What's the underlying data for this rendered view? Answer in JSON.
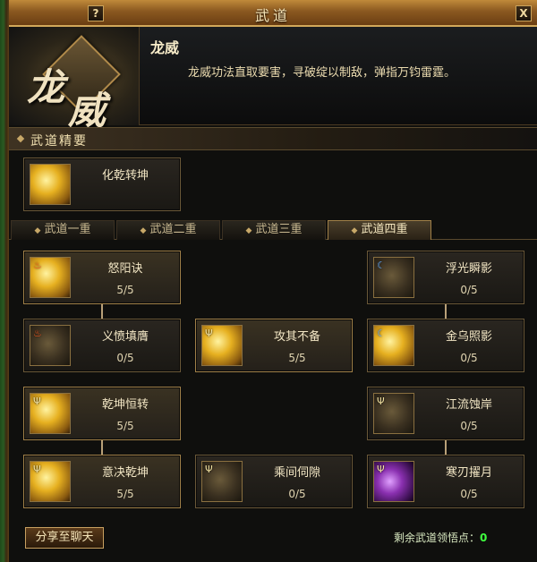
{
  "window": {
    "title": "武道",
    "help_label": "?",
    "close_label": "X"
  },
  "emblem": {
    "char1": "龙",
    "char2": "威"
  },
  "skill": {
    "name": "龙威",
    "description": "龙威功法直取要害，寻破绽以制敌，弹指万钧雷霆。"
  },
  "essentials": {
    "title": "武道精要",
    "item": {
      "name": "化乾转坤"
    }
  },
  "tabs": [
    {
      "label": "武道一重"
    },
    {
      "label": "武道二重"
    },
    {
      "label": "武道三重"
    },
    {
      "label": "武道四重",
      "active": true
    }
  ],
  "skills": [
    {
      "name": "怒阳诀",
      "level": "5/5"
    },
    {
      "name": "浮光瞬影",
      "level": "0/5"
    },
    {
      "name": "义愤填膺",
      "level": "0/5"
    },
    {
      "name": "攻其不备",
      "level": "5/5"
    },
    {
      "name": "金乌照影",
      "level": "0/5"
    },
    {
      "name": "乾坤恒转",
      "level": "5/5"
    },
    {
      "name": "江流蚀岸",
      "level": "0/5"
    },
    {
      "name": "意决乾坤",
      "level": "5/5"
    },
    {
      "name": "乘间伺隙",
      "level": "0/5"
    },
    {
      "name": "寒刃擢月",
      "level": "0/5"
    }
  ],
  "footer": {
    "share_label": "分享至聊天",
    "points_label": "剩余武道领悟点：",
    "points_value": "0"
  },
  "colors": {
    "points_value": "#40ff40",
    "border_gold": "#a08048"
  }
}
